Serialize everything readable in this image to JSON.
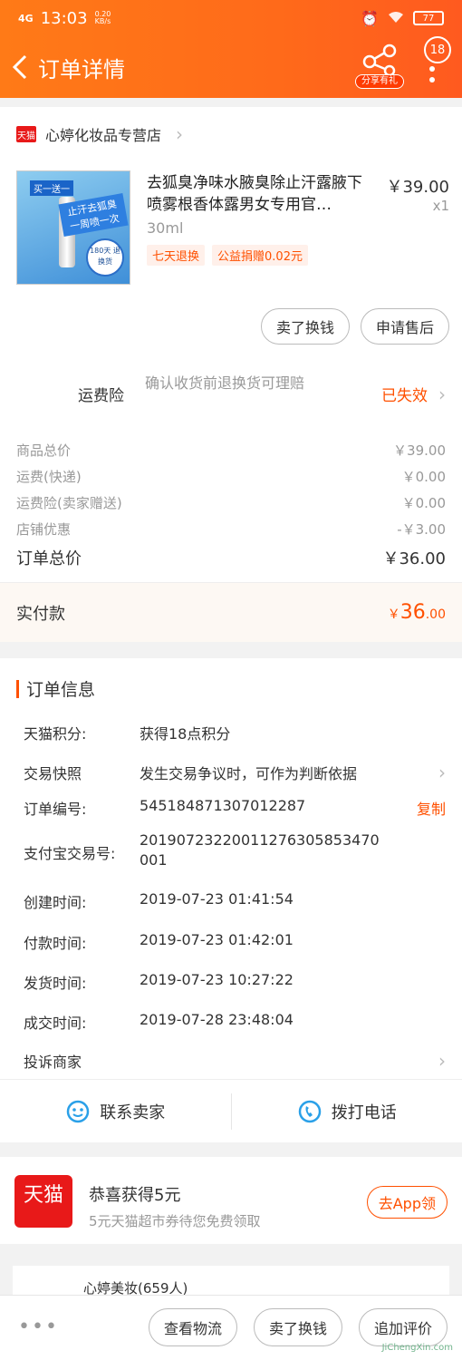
{
  "status_bar": {
    "signal": "4G",
    "time": "13:03",
    "speed_value": "0.20",
    "speed_unit": "KB/s",
    "battery": "77"
  },
  "header": {
    "title": "订单详情",
    "share_label": "分享有礼",
    "badge": "18"
  },
  "shop": {
    "badge": "天猫",
    "name": "心婷化妆品专营店"
  },
  "product": {
    "name": "去狐臭净味水腋臭除止汗露腋下喷雾根香体露男女专用官…",
    "price": "￥39.00",
    "qty": "x1",
    "spec": "30ml",
    "tags": [
      "七天退换",
      "公益捐赠0.02元"
    ],
    "image_text": {
      "tag1": "买一送一",
      "tag2": "止汗去狐臭 一周喷一次",
      "seal": "180天 退换货"
    }
  },
  "actions": {
    "sell_swap": "卖了换钱",
    "after_sale": "申请售后"
  },
  "insurance": {
    "label": "运费险",
    "desc": "确认收货前退换货可理赔",
    "status": "已失效"
  },
  "summary": [
    {
      "label": "商品总价",
      "value": "￥39.00"
    },
    {
      "label": "运费(快递)",
      "value": "￥0.00"
    },
    {
      "label": "运费险(卖家赠送)",
      "value": "￥0.00"
    },
    {
      "label": "店铺优惠",
      "value": "-￥3.00"
    }
  ],
  "total": {
    "label": "订单总价",
    "value": "￥36.00"
  },
  "paid": {
    "label": "实付款",
    "currency": "￥",
    "integer": "36",
    "decimal": ".00"
  },
  "order_info": {
    "title": "订单信息",
    "points_label": "天猫积分:",
    "points_value": "获得18点积分",
    "snapshot_label": "交易快照",
    "snapshot_value": "发生交易争议时，可作为判断依据",
    "order_no_label": "订单编号:",
    "order_no_value": "545184871307012287",
    "copy": "复制",
    "alipay_label": "支付宝交易号:",
    "alipay_value": "20190723220011276305853470001",
    "created_label": "创建时间:",
    "created_value": "2019-07-23 01:41:54",
    "paid_label": "付款时间:",
    "paid_value": "2019-07-23 01:42:01",
    "shipped_label": "发货时间:",
    "shipped_value": "2019-07-23 10:27:22",
    "done_label": "成交时间:",
    "done_value": "2019-07-28 23:48:04",
    "complain_label": "投诉商家"
  },
  "contact": {
    "seller": "联系卖家",
    "call": "拨打电话"
  },
  "promo": {
    "logo": "天猫",
    "title": "恭喜获得5元",
    "desc": "5元天猫超市券待您免费领取",
    "cta": "去App领"
  },
  "peek": {
    "text": "心婷美妆(659人)"
  },
  "bottom_bar": {
    "more": "•••",
    "logistics": "查看物流",
    "sell_swap": "卖了换钱",
    "review": "追加评价"
  },
  "watermark": "JiChengXin.com",
  "colors": {
    "accent": "#ff5000",
    "header": "#ff6a1a",
    "tmall_red": "#e81919"
  }
}
